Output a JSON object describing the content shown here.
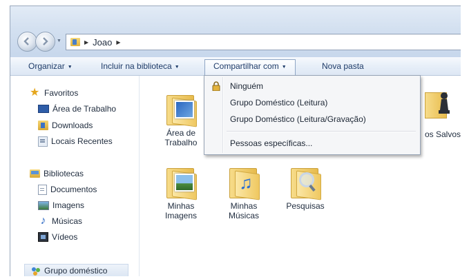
{
  "address": {
    "crumbs": [
      "Joao"
    ]
  },
  "toolbar": {
    "organize": "Organizar",
    "include": "Incluir na biblioteca",
    "share": "Compartilhar com",
    "new_folder": "Nova pasta"
  },
  "nav": {
    "favorites": {
      "title": "Favoritos",
      "items": [
        "Área de Trabalho",
        "Downloads",
        "Locais Recentes"
      ]
    },
    "libraries": {
      "title": "Bibliotecas",
      "items": [
        "Documentos",
        "Imagens",
        "Músicas",
        "Vídeos"
      ]
    },
    "homegroup": "Grupo doméstico"
  },
  "folders": [
    {
      "label1": "Área de",
      "label2": "Trabalho"
    },
    {
      "label1": "Minhas",
      "label2": "Imagens"
    },
    {
      "label1": "Minhas",
      "label2": "Músicas"
    },
    {
      "label1": "Pesquisas",
      "label2": ""
    },
    {
      "label1": "os Salvos",
      "label2": ""
    }
  ],
  "share_menu": {
    "items": [
      "Ninguém",
      "Grupo Doméstico (Leitura)",
      "Grupo Doméstico (Leitura/Gravação)",
      "Pessoas específicas..."
    ]
  },
  "colors": {
    "toolbar_text": "#1e3b68",
    "menu_bg": "#f5f6f8",
    "folder_yellow": "#efc861"
  },
  "icons": [
    "back-icon",
    "forward-icon",
    "folder-icon",
    "star-icon",
    "lock-icon",
    "music-note-icon",
    "magnifier-icon"
  ]
}
